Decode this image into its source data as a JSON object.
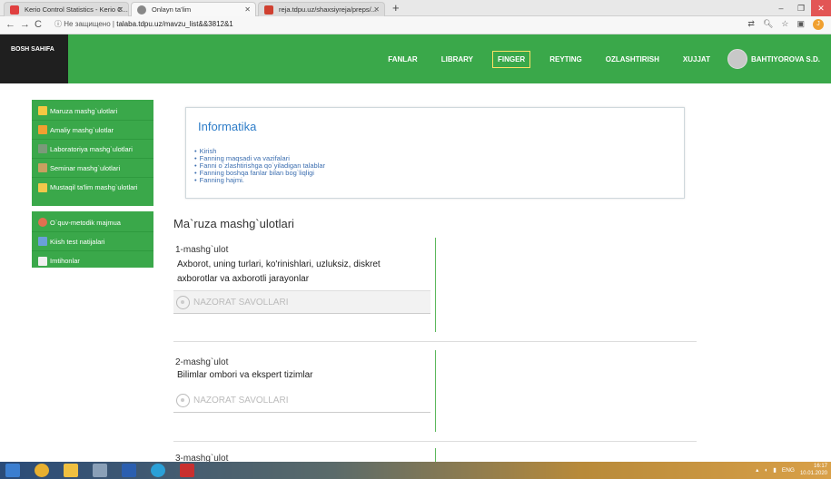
{
  "browser": {
    "tabs": [
      {
        "title": "Kerio Control Statistics - Kerio C...",
        "active": false,
        "favicon_color": "#e04040"
      },
      {
        "title": "Onlayn ta'lim",
        "active": true,
        "favicon_color": "#888888"
      },
      {
        "title": "reja.tdpu.uz/shaxsiyreja/preps/...",
        "active": false,
        "favicon_color": "#d04030"
      }
    ],
    "security_label": "Не защищено",
    "url": "talaba.tdpu.uz/mavzu_list&&3812&1"
  },
  "header": {
    "logo": "BOSH SAHIFA",
    "nav": [
      "FANLAR",
      "LIBRARY",
      "FINGER",
      "REYTING",
      "OZLASHTIRISH",
      "XUJJAT"
    ],
    "active_nav": "FINGER",
    "user_name": "BAHTIYOROVA S.D.",
    "brand_color": "#3aa84a"
  },
  "sidebar": {
    "group1": [
      {
        "label": "Maruza mashg`ulotlari",
        "icon": "folder-icon",
        "color": "#f5c842"
      },
      {
        "label": "Amaliy mashg`ulotlar",
        "icon": "pencil-icon",
        "color": "#f0a030"
      },
      {
        "label": "Laboratoriya mashg`ulotlari",
        "icon": "tools-icon",
        "color": "#7a9a7a"
      },
      {
        "label": "Seminar mashg`ulotlari",
        "icon": "book-icon",
        "color": "#c8a060"
      },
      {
        "label": "Mustaqil ta'lim mashg`ulotlari",
        "icon": "stack-icon",
        "color": "#f2c84b"
      }
    ],
    "group2": [
      {
        "label": "O`quv-metodik majmua",
        "icon": "people-icon",
        "color": "#e07050"
      },
      {
        "label": "Kiish test natijalari",
        "icon": "calendar-icon",
        "color": "#6aa0d8"
      },
      {
        "label": "Imtihonlar",
        "icon": "document-icon",
        "color": "#f0f0f0"
      }
    ]
  },
  "info": {
    "title": "Informatika",
    "items": [
      "Kirish",
      "Fanning maqsadi va vazifalari",
      "Fanni o`zlashtirishga qo`yiladigan talablar",
      "Fanning boshqa fanlar bilan bog`liqligi",
      "Fanning hajmi."
    ]
  },
  "main": {
    "section_title": "Ma`ruza mashg`ulotlari",
    "nazorat_label": "NAZORAT SAVOLLARI",
    "lessons": [
      {
        "number": "1-mashg`ulot",
        "description": "Axborot, uning turlari, ko'rinishlari, uzluksiz, diskret axborotlar va axborotli jarayonlar"
      },
      {
        "number": "2-mashg`ulot",
        "description": "Bilimlar ombori va ekspert tizimlar"
      },
      {
        "number": "3-mashg`ulot",
        "description": ""
      }
    ]
  },
  "taskbar": {
    "language": "ENG",
    "time": "16:17",
    "date": "10.01.2020"
  }
}
